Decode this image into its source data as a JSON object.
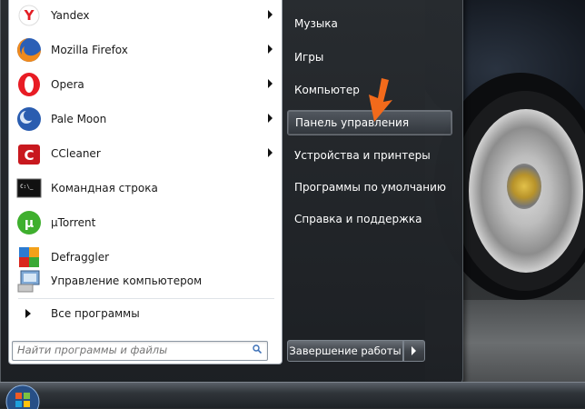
{
  "start_menu": {
    "programs": [
      {
        "label": "Yandex",
        "icon": "yandex-icon",
        "has_submenu": true
      },
      {
        "label": "Mozilla Firefox",
        "icon": "firefox-icon",
        "has_submenu": true
      },
      {
        "label": "Opera",
        "icon": "opera-icon",
        "has_submenu": true
      },
      {
        "label": "Pale Moon",
        "icon": "pale-moon-icon",
        "has_submenu": true
      },
      {
        "label": "CCleaner",
        "icon": "ccleaner-icon",
        "has_submenu": true
      },
      {
        "label": "Командная строка",
        "icon": "command-prompt-icon",
        "has_submenu": false
      },
      {
        "label": "µTorrent",
        "icon": "utorrent-icon",
        "has_submenu": false
      },
      {
        "label": "Defraggler",
        "icon": "defraggler-icon",
        "has_submenu": false
      },
      {
        "label": "Управление компьютером",
        "icon": "computer-management-icon",
        "has_submenu": false
      }
    ],
    "all_programs_label": "Все программы",
    "search": {
      "placeholder": "Найти программы и файлы",
      "value": ""
    },
    "right_items": [
      {
        "label": "Музыка"
      },
      {
        "label": "Игры"
      },
      {
        "label": "Компьютер"
      },
      {
        "label": "Панель управления",
        "highlighted": true
      },
      {
        "label": "Устройства и принтеры"
      },
      {
        "label": "Программы по умолчанию"
      },
      {
        "label": "Справка и поддержка"
      }
    ],
    "shutdown_label": "Завершение работы"
  },
  "colors": {
    "annotation_arrow": "#f26a1b",
    "accent": "#3b6fb6"
  }
}
